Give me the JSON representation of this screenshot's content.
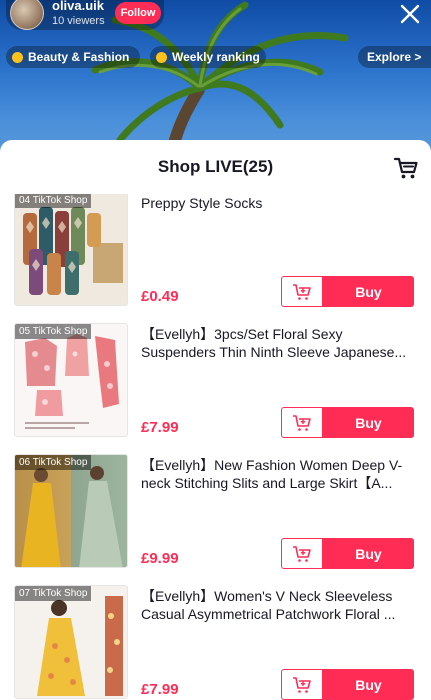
{
  "host": {
    "name": "oliva.uik",
    "viewers": "10 viewers",
    "follow_label": "Follow"
  },
  "chips": {
    "beauty": "Beauty & Fashion",
    "ranking": "Weekly ranking",
    "explore": "Explore >"
  },
  "sheet": {
    "title": "Shop LIVE(25)"
  },
  "products": [
    {
      "tag": "04  TikTok Shop",
      "title": "Preppy Style Socks",
      "price": "£0.49",
      "buy_label": "Buy"
    },
    {
      "tag": "05  TikTok Shop",
      "title": "【Evellyh】3pcs/Set Floral Sexy Suspenders Thin Ninth Sleeve Japanese...",
      "price": "£7.99",
      "buy_label": "Buy"
    },
    {
      "tag": "06  TikTok Shop",
      "title": "【Evellyh】New Fashion Women Deep V-neck Stitching Slits and Large Skirt【A...",
      "price": "£9.99",
      "buy_label": "Buy"
    },
    {
      "tag": "07  TikTok Shop",
      "title": "【Evellyh】Women's V Neck Sleeveless Casual  Asymmetrical Patchwork Floral ...",
      "price": "£7.99",
      "buy_label": "Buy"
    }
  ],
  "icons": {
    "close": "close-icon",
    "cart": "shopping-cart-icon",
    "add_to_cart": "add-to-cart-icon"
  },
  "colors": {
    "accent": "#ff2c55",
    "chip_dot": "#ffc21a"
  }
}
